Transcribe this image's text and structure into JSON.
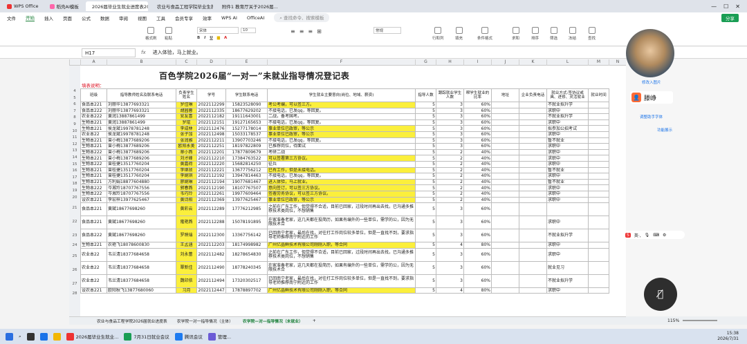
{
  "tabs": [
    "WPS Office",
    "稻壳AI模板",
    "2026届毕业生就业进度表2026-7-20",
    "农业与食品工程学院毕业生就业...",
    "附件1 教育厅关于2026届..."
  ],
  "menu": [
    "文件",
    "开始",
    "插入",
    "页面",
    "公式",
    "数据",
    "审阅",
    "视图",
    "工具",
    "会员专享",
    "效率",
    "WPS AI",
    "OfficeAI"
  ],
  "menu_selected": "开始",
  "search_placeholder": "查找命令、搜索模板",
  "share_label": "分享",
  "ribbon_labels": [
    "格式刷",
    "粘贴",
    "宋体",
    "10",
    "常规",
    "行和列",
    "填充",
    "排序",
    "查找",
    "条件格式",
    "单元格样式",
    "表格样式",
    "求和",
    "筛选",
    "冻结",
    "工作表"
  ],
  "name_box": "H17",
  "formula_fx": "fx",
  "formula_text": "进入体验，马上就业。",
  "col_letters": [
    "A",
    "B",
    "C",
    "D",
    "E",
    "F",
    "G",
    "H",
    "I",
    "J",
    "K",
    "L",
    "M",
    "N",
    "O"
  ],
  "title": "百色学院2026届“一对一”未就业指导情况登记表",
  "note": "填表说明：",
  "headers": [
    "班级",
    "指导教师姓名及联系电话",
    "负责学生姓名",
    "学号",
    "学生联系电话",
    "学生就业主要意向(岗位、地域、薪资)",
    "指导人数",
    "跟踪就业学生人数",
    "帮学生就业的比率",
    "地址",
    "企业负责电话",
    "就业方式:签协议或具、进修、灵活就业",
    "就业时间"
  ],
  "rows": [
    {
      "n": "4",
      "cls": "食品本221",
      "teacher": "刘丽华13877693321",
      "stu": "罗佳琳",
      "id": "2022112299",
      "tel": "15823528090",
      "intent": "考公考编，可以签三方。",
      "hl": true,
      "a": "5",
      "b": "3",
      "pct": "60%",
      "mode": "不就业拟升学"
    },
    {
      "n": "5",
      "cls": "食品本222",
      "teacher": "刘丽华13877693321",
      "stu": "胡园蓉",
      "id": "2022112335",
      "tel": "18677629202",
      "intent": "不接电话，已发qq，等回复。",
      "hl": false,
      "a": "5",
      "b": "3",
      "pct": "60%",
      "mode": "求职中"
    },
    {
      "n": "6",
      "cls": "农业本222",
      "teacher": "黄润13887861499",
      "stu": "安友喜",
      "id": "2022112182",
      "tel": "19111643001",
      "intent": "二战，备考国考。",
      "hl": false,
      "a": "5",
      "b": "3",
      "pct": "60%",
      "mode": "不就业拟升学"
    },
    {
      "n": "7",
      "cls": "生物本221",
      "teacher": "黄润13887861499",
      "stu": "罗琨",
      "id": "2022112151",
      "tel": "19127165653",
      "intent": "不接电话，已发qq，等回复。",
      "hl": false,
      "a": "5",
      "b": "3",
      "pct": "60%",
      "mode": "求职中"
    },
    {
      "n": "8",
      "cls": "生物本221",
      "teacher": "侯龙斌19978781248",
      "stu": "李成林",
      "id": "2022112476",
      "tel": "15277178014",
      "intent": "事业单位已政审，等公示",
      "hl": true,
      "a": "5",
      "b": "3",
      "pct": "60%",
      "mode": "拟参加公招考试"
    },
    {
      "n": "9",
      "cls": "农业本22",
      "teacher": "侯龙斌19978781248",
      "stu": "张子加",
      "id": "2022112498",
      "tel": "15033178537",
      "intent": "事业单位已政审，等公示",
      "hl": true,
      "a": "5",
      "b": "3",
      "pct": "60%",
      "mode": "求职中"
    },
    {
      "n": "10",
      "cls": "生物本221",
      "teacher": "曾小梅13877689206",
      "stu": "张润雅",
      "id": "2022112211",
      "tel": "13907703246",
      "intent": "不接电话，已发qq，等回复。",
      "hl": false,
      "a": "5",
      "b": "3",
      "pct": "60%",
      "mode": "暂不就业"
    },
    {
      "n": "11",
      "cls": "生物本221",
      "teacher": "曾小梅13877689206",
      "stu": "欧阳永美",
      "id": "2022112251",
      "tel": "18197822809",
      "intent": "已推荐岗位，待面试",
      "hl": false,
      "a": "5",
      "b": "3",
      "pct": "60%",
      "mode": "求职中"
    },
    {
      "n": "12",
      "cls": "生物本222",
      "teacher": "曾小梅13877689206",
      "stu": "覃小燕",
      "id": "2022112201",
      "tel": "17877809679",
      "intent": "考研二战",
      "hl": false,
      "a": "5",
      "b": "2",
      "pct": "40%",
      "mode": "求职中"
    },
    {
      "n": "13",
      "cls": "生物本221",
      "teacher": "曾小梅13877689206",
      "stu": "刘才峰",
      "id": "2022112210",
      "tel": "17384763522",
      "intent": "可以签署第三方协议。",
      "hl": true,
      "a": "5",
      "b": "2",
      "pct": "40%",
      "mode": "求职中"
    },
    {
      "n": "14",
      "cls": "生物本222",
      "teacher": "曾桂捷13517760204",
      "stu": "黄嘉荷",
      "id": "2022112220",
      "tel": "15682814250",
      "intent": "征兵",
      "hl": false,
      "a": "5",
      "b": "2",
      "pct": "40%",
      "mode": "求职中"
    },
    {
      "n": "15",
      "cls": "生物本221",
      "teacher": "曾桂捷13517760204",
      "stu": "李继祯",
      "id": "2022112221",
      "tel": "13677756212",
      "intent": "已有工作，但是未接电话。",
      "hl": true,
      "a": "5",
      "b": "2",
      "pct": "40%",
      "mode": "暂不就业"
    },
    {
      "n": "16",
      "cls": "生物本221",
      "teacher": "曾桂捷13517760204",
      "stu": "李婉琪",
      "id": "2022112192",
      "tel": "13947814463",
      "intent": "不接电话，已发qq，等回复。",
      "hl": false,
      "a": "5",
      "b": "2",
      "pct": "40%",
      "mode": "求职中"
    },
    {
      "n": "17",
      "cls": "生物本221",
      "teacher": "方利娟18877604880",
      "stu": "廖婉琳",
      "id": "2022112194",
      "tel": "19077681467",
      "intent": "进入体验，马上就业。",
      "hl": true,
      "a": "5",
      "b": "2",
      "pct": "40%",
      "mode": "暂不就业"
    },
    {
      "n": "18",
      "cls": "生物本222",
      "teacher": "岑湘玲18707767556",
      "stu": "郭春燕",
      "id": "2022112190",
      "tel": "18107767507",
      "intent": "意向签订，可以签三方协议。",
      "hl": true,
      "a": "5",
      "b": "2",
      "pct": "40%",
      "mode": "求职中"
    },
    {
      "n": "19",
      "cls": "生物本222",
      "teacher": "岑湘玲18707767556",
      "stu": "韦巧玲",
      "id": "2022112261",
      "tel": "19977609464",
      "intent": "签署劳务协议，可以签三方协议。",
      "hl": true,
      "a": "5",
      "b": "2",
      "pct": "40%",
      "mode": "求职中"
    },
    {
      "n": "20",
      "cls": "设农本221",
      "teacher": "李宏梓13977625467",
      "stu": "黄诗阳",
      "id": "2022112369",
      "tel": "13977625467",
      "intent": "事业单位已政审，等公示",
      "hl": true,
      "a": "5",
      "b": "2",
      "pct": "40%",
      "mode": "求职中"
    },
    {
      "n": "21",
      "cls": "食品本221",
      "teacher": "黄斌18677698260",
      "stu": "黄彩云",
      "id": "2022112289",
      "tel": "17776212985",
      "intent": "之前在广东工作，但觉得不合适，目前已回家，过段时间再出去找，已沟通多推荐技术类岗位，不想销售",
      "hl": false,
      "tall": true,
      "a": "5",
      "b": "3",
      "pct": "60%",
      "mode": ""
    },
    {
      "n": "22",
      "cls": "食品本221",
      "teacher": "黄斌18677698260",
      "stu": "隆艳燕",
      "id": "2022112288",
      "tel": "15078191895",
      "intent": "在家准备老家，这几天都在投简历，如果有编外的一些单位，需学的公，因为无限技术合",
      "hl": false,
      "tall": true,
      "a": "5",
      "b": "3",
      "pct": "60%",
      "mode": "求职中"
    },
    {
      "n": "23",
      "cls": "食品本222",
      "teacher": "黄斌18677698260",
      "stu": "罗映瑞",
      "id": "2022112300",
      "tel": "13367756142",
      "intent": "已回南宁老家，最后在找，对往打工作岗位较多单位，但是一直找不到，要求指导老师推荐南宁附近的工作",
      "hl": false,
      "tall": true,
      "a": "5",
      "b": "3",
      "pct": "60%",
      "mode": "不就业拟升学"
    },
    {
      "n": "24",
      "cls": "生物本221",
      "teacher": "农艳飞18078600830",
      "stu": "王孟涵",
      "id": "2022112203",
      "tel": "18174998982",
      "intent": "广州亿晶鲜技术有限公司刚刚入职，等合同",
      "hl": true,
      "a": "5",
      "b": "4",
      "pct": "80%",
      "mode": "求职中"
    },
    {
      "n": "25",
      "cls": "农业本22",
      "teacher": "韦兰清18377684658",
      "stu": "刘永蕾",
      "id": "2022112482",
      "tel": "18278654830",
      "intent": "之前在广东工作，但觉得不合适，目前已回家，过段时间再出去找，已沟通多推荐技术类岗位，不想销售",
      "hl": false,
      "tall": true,
      "a": "5",
      "b": "3",
      "pct": "60%",
      "mode": "求职中"
    },
    {
      "n": "26",
      "cls": "农业本22",
      "teacher": "韦兰清18377684658",
      "stu": "覃新佳",
      "id": "2022112490",
      "tel": "18778240345",
      "intent": "在家准备老家，这几天都在投简历，如果有编外的一些单位，需学的公，因为无限技术合",
      "hl": false,
      "tall": true,
      "a": "5",
      "b": "3",
      "pct": "60%",
      "mode": "就业见习"
    },
    {
      "n": "27",
      "cls": "农业本22",
      "teacher": "韦兰清18377684658",
      "stu": "魏印依",
      "id": "2022112494",
      "tel": "17320302517",
      "intent": "已回南宁老家，最后在找，对往打工作岗位较多单位，但是一直找不到，要求指导老师推荐南宁附近的工作",
      "hl": false,
      "tall": true,
      "a": "5",
      "b": "3",
      "pct": "60%",
      "mode": "不就业拟升学"
    },
    {
      "n": "28",
      "cls": "设农本221",
      "teacher": "欧阳秋飞13877680060",
      "stu": "习月",
      "id": "2022112447",
      "tel": "17878897702",
      "intent": "广州亿晶鲜技术有限公司刚刚入职，等合同",
      "hl": true,
      "a": "5",
      "b": "4",
      "pct": "80%",
      "mode": "求职中"
    }
  ],
  "sheet_tabs": [
    "农业与食品工程学院2026届就业进度表",
    "农学院一对一指导情况（主体）",
    "农学院—对—指导情况（未就业）"
  ],
  "sheet_tab_active": "农学院—对—指导情况（未就业）",
  "zoom": "115%",
  "meeting": {
    "speaker_name": "滕峥",
    "side_links": [
      "修改入图片",
      "调整助手字体",
      "功能展示"
    ]
  },
  "floating_toolbar": "英·,",
  "taskbar": {
    "items": [
      "2026届毕业生就业...",
      "7月31日就业会议",
      "腾讯会议",
      "管理..."
    ],
    "time": "15:38",
    "date": "2026/7/31"
  }
}
